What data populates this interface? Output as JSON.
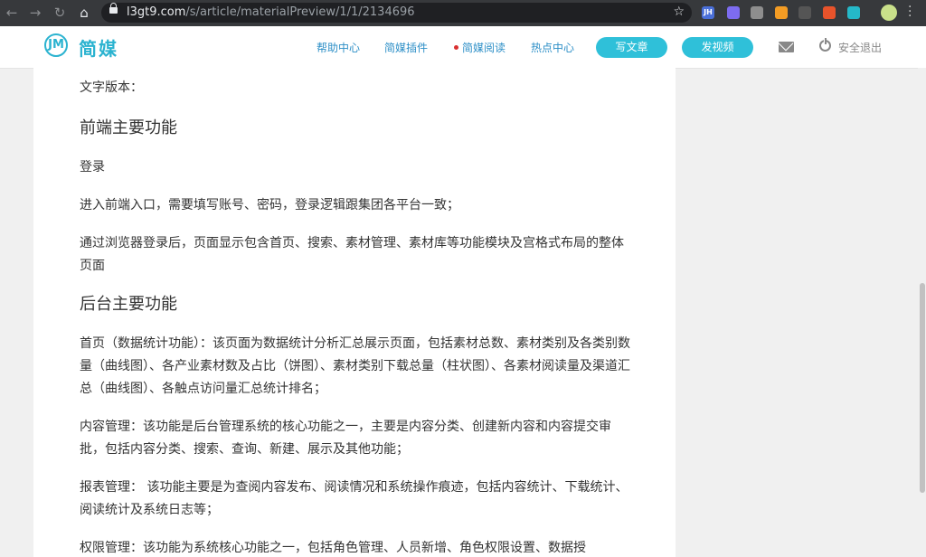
{
  "browser": {
    "url_host": "l3gt9.com",
    "url_path": "/s/article/materialPreview/1/1/2134696",
    "extensions": [
      {
        "name": "jh-extension-icon",
        "label": "JH",
        "color": "#4a6fd8"
      },
      {
        "name": "circle-extension-icon",
        "label": "",
        "color": "#7d6cf0"
      },
      {
        "name": "gear-extension-icon",
        "label": "",
        "color": "#8e8e8e"
      },
      {
        "name": "orange-extension-icon",
        "label": "",
        "color": "#f39c24"
      },
      {
        "name": "qr-extension-icon",
        "label": "",
        "color": "#555555"
      },
      {
        "name": "x-extension-icon",
        "label": "",
        "color": "#e8532b"
      },
      {
        "name": "teal-extension-icon",
        "label": "",
        "color": "#25b8c8"
      }
    ]
  },
  "site": {
    "logo_mark": "JM",
    "logo_text": "简媒",
    "nav": {
      "help": "帮助中心",
      "plugin": "简媒插件",
      "read": "简媒阅读",
      "hot": "热点中心"
    },
    "write_button": "写文章",
    "video_button": "发视频",
    "logout": "安全退出"
  },
  "article": {
    "intro": "文字版本：",
    "section1": "前端主要功能",
    "login": "登录",
    "p1": "进入前端入口，需要填写账号、密码，登录逻辑跟集团各平台一致；",
    "p2": "通过浏览器登录后，页面显示包含首页、搜索、素材管理、素材库等功能模块及宫格式布局的整体页面",
    "section2": "后台主要功能",
    "p3": "首页（数据统计功能）：该页面为数据统计分析汇总展示页面，包括素材总数、素材类别及各类别数量（曲线图）、各产业素材数及占比（饼图）、素材类别下载总量（柱状图）、各素材阅读量及渠道汇总（曲线图）、各触点访问量汇总统计排名；",
    "p4": "内容管理：该功能是后台管理系统的核心功能之一，主要是内容分类、创建新内容和内容提交审批，包括内容分类、搜索、查询、新建、展示及其他功能；",
    "p5": "报表管理： 该功能主要是为查阅内容发布、阅读情况和系统操作痕迹，包括内容统计、下载统计、阅读统计及系统日志等；",
    "p6": "权限管理：该功能为系统核心功能之一，包括角色管理、人员新增、角色权限设置、数据授"
  },
  "colors": {
    "brand": "#2bb3d0",
    "nav_link": "#2d8fc7",
    "active_dot": "#d93030"
  }
}
